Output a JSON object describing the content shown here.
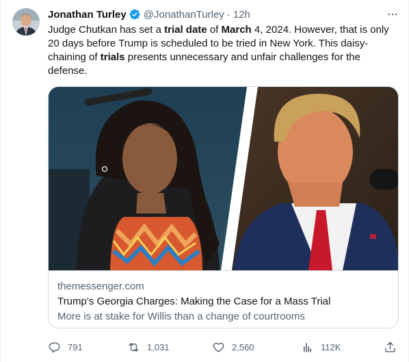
{
  "tweet": {
    "author_name": "Jonathan Turley",
    "author_handle": "@JonathanTurley",
    "separator": "·",
    "time": "12h",
    "more_label": "···",
    "text_parts": [
      {
        "text": "Judge Chutkan has set a ",
        "bold": false
      },
      {
        "text": "trial date",
        "bold": true
      },
      {
        "text": " of ",
        "bold": false
      },
      {
        "text": "March",
        "bold": true
      },
      {
        "text": " 4, 2024. However, that is only 20 days before Trump is scheduled to be tried in New York. This daisy-chaining of ",
        "bold": false
      },
      {
        "text": "trials",
        "bold": true
      },
      {
        "text": " presents unnecessary and unfair challenges for the defense.",
        "bold": false
      }
    ]
  },
  "card": {
    "domain": "themessenger.com",
    "title": "Trump’s Georgia Charges: Making the Case for a Mass Trial",
    "description": "More is at stake for Willis than a change of courtrooms"
  },
  "actions": {
    "replies": "791",
    "retweets": "1,031",
    "likes": "2,560",
    "views": "112K"
  },
  "colors": {
    "text": "#0f1419",
    "secondary": "#536471",
    "verified": "#1d9bf0",
    "border": "#cfd9de"
  },
  "icons": [
    "verified-badge-icon",
    "more-icon",
    "reply-icon",
    "retweet-icon",
    "like-icon",
    "views-icon",
    "share-icon"
  ]
}
